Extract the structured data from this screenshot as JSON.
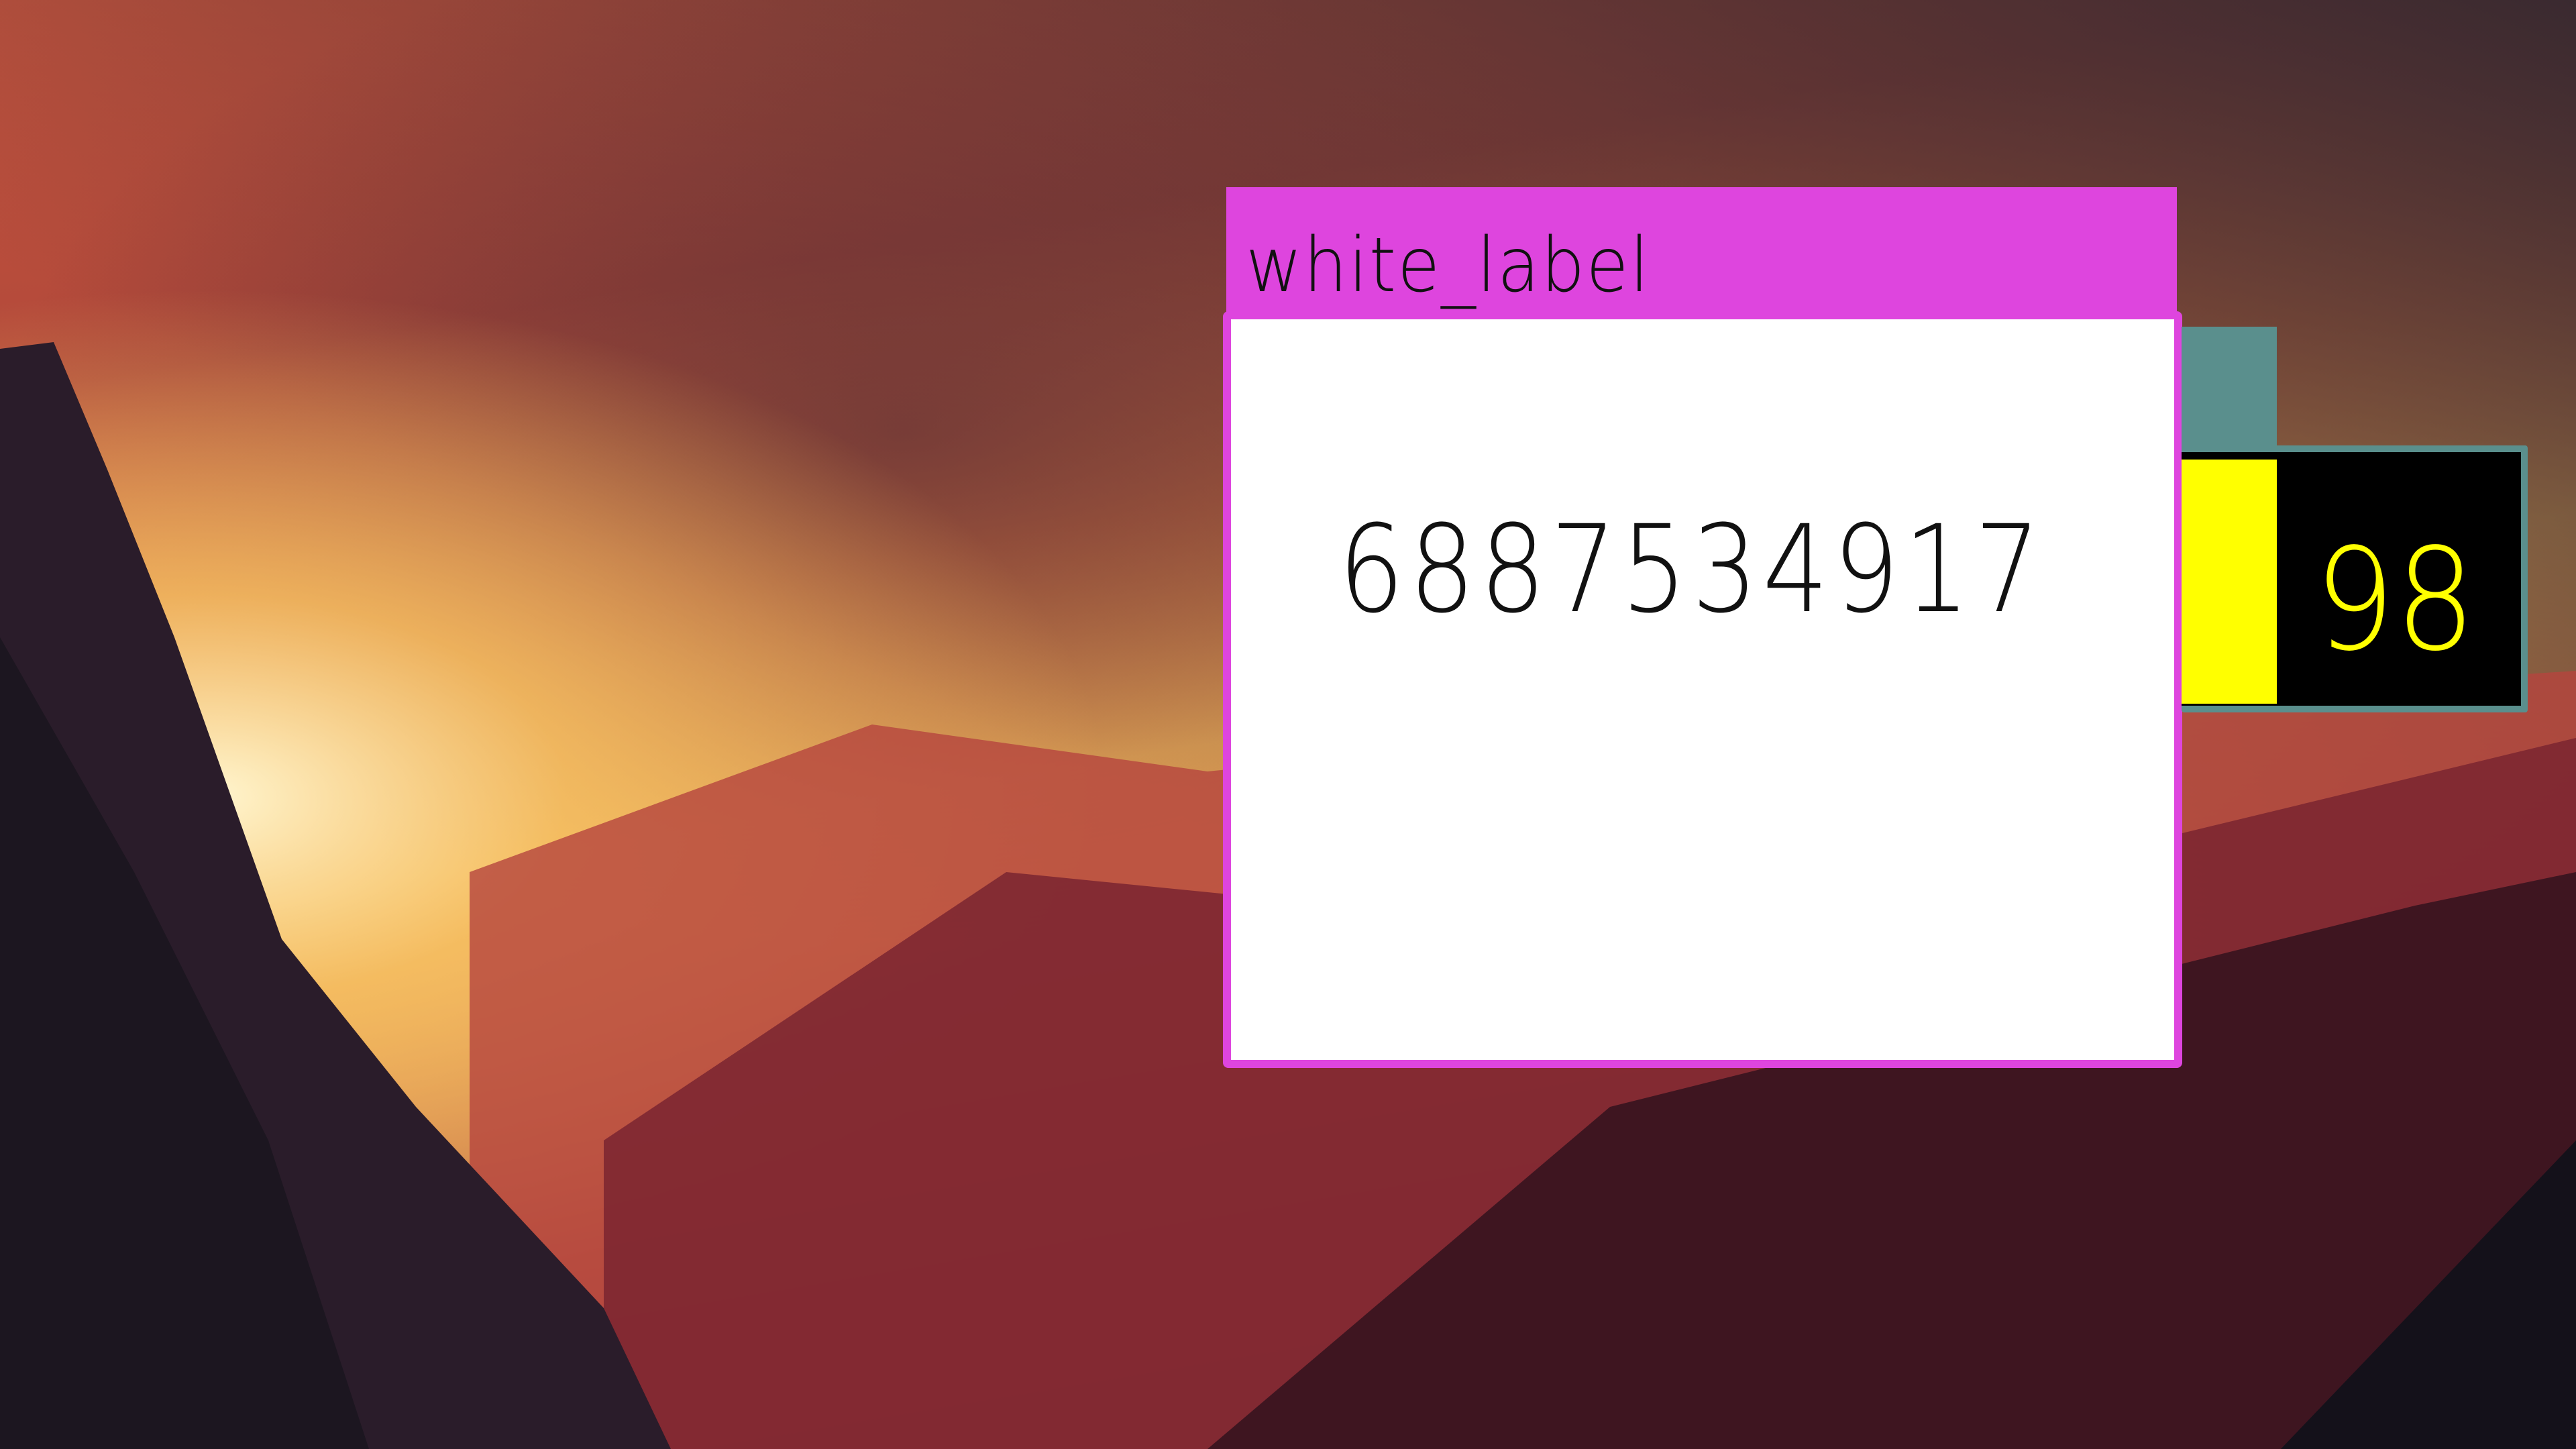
{
  "desktop": {
    "wallpaper": "sunset mountain valley"
  },
  "main_window": {
    "title": "white_label",
    "value": "6887534917",
    "accent_color": "#de45de",
    "background_color": "#ffffff"
  },
  "side_window": {
    "value": "98",
    "accent_color": "#5a8f8d",
    "swatch_color": "#ffff00",
    "panel_color": "#000000",
    "text_color": "#ffff00"
  }
}
